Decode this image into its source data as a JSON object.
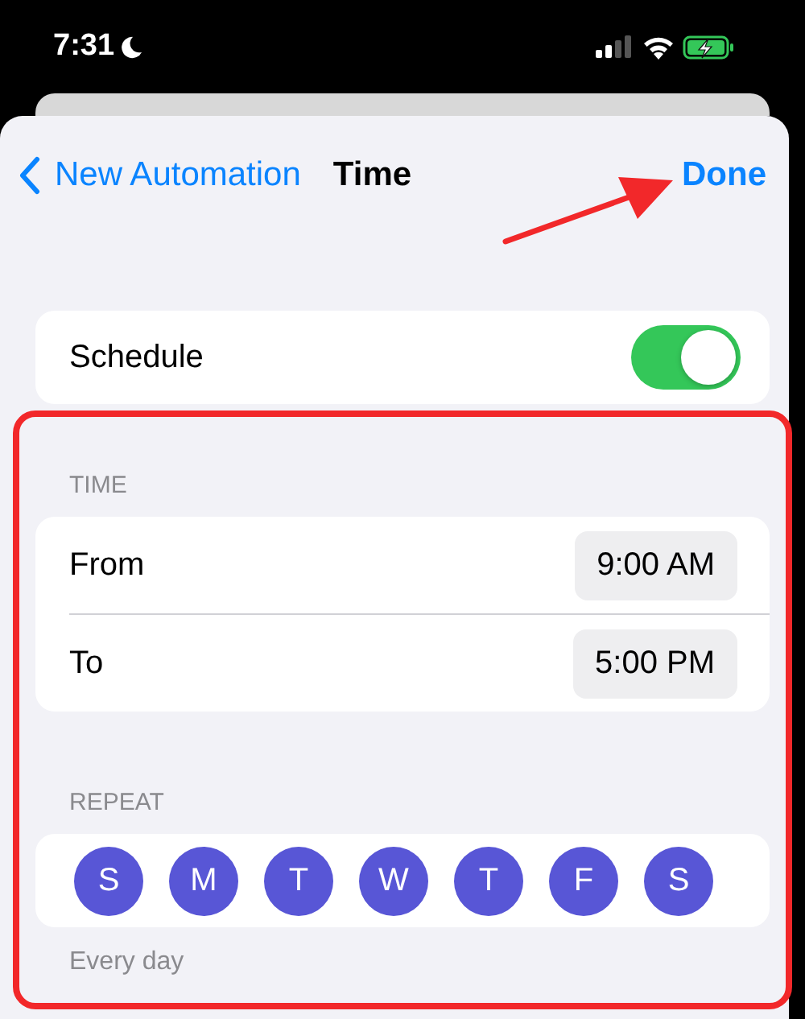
{
  "status_bar": {
    "time": "7:31",
    "focus_moon": true
  },
  "nav": {
    "back": "New Automation",
    "title": "Time",
    "done": "Done"
  },
  "schedule": {
    "label": "Schedule",
    "on": true
  },
  "time_section": {
    "header": "TIME",
    "rows": [
      {
        "label": "From",
        "value": "9:00 AM"
      },
      {
        "label": "To",
        "value": "5:00 PM"
      }
    ]
  },
  "repeat_section": {
    "header": "REPEAT",
    "days": [
      {
        "label": "S",
        "selected": true
      },
      {
        "label": "M",
        "selected": true
      },
      {
        "label": "T",
        "selected": true
      },
      {
        "label": "W",
        "selected": true
      },
      {
        "label": "T",
        "selected": true
      },
      {
        "label": "F",
        "selected": true
      },
      {
        "label": "S",
        "selected": true
      }
    ],
    "footer": "Every day"
  }
}
